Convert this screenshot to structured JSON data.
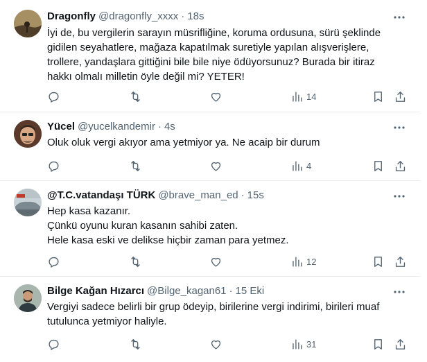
{
  "tweets": [
    {
      "name": "Dragonfly",
      "handle": "@dragonfly_xxxx",
      "separator": "·",
      "time": "18s",
      "lines": [
        "İyi de, bu vergilerin sarayın müsrifliğine, koruma ordusuna, sürü şeklinde",
        "gidilen seyahatlere, mağaza kapatılmak suretiyle yapılan alışverişlere,",
        "trollere, yandaşlara gittiğini bile bile niye ödüyorsunuz? Burada bir itiraz",
        "hakkı olmalı milletin öyle değil mi? YETER!"
      ],
      "views": "14"
    },
    {
      "name": "Yücel",
      "handle": "@yucelkandemir",
      "separator": "·",
      "time": "4s",
      "lines": [
        "Oluk oluk vergi akıyor ama yetmiyor ya. Ne acaip bir durum"
      ],
      "views": "4"
    },
    {
      "name": "@T.C.vatandaşı TÜRK",
      "handle": "@brave_man_ed",
      "separator": "·",
      "time": "15s",
      "lines": [
        "Hep kasa kazanır.",
        "Çünkü oyunu kuran kasanın sahibi zaten.",
        "Hele kasa eski ve delikse hiçbir zaman para yetmez."
      ],
      "views": "12"
    },
    {
      "name": "Bilge Kağan Hızarcı",
      "handle": "@Bilge_kagan61",
      "separator": "·",
      "time": "15 Eki",
      "lines": [
        "Vergiyi sadece belirli bir grup ödeyip, birilerine vergi indirimi, birileri muaf",
        "tutulunca yetmiyor haliyle."
      ],
      "views": "31"
    }
  ],
  "icons": {
    "more": "more-horizontal-icon",
    "reply": "reply-icon",
    "retweet": "retweet-icon",
    "like": "heart-icon",
    "views": "views-bar-chart-icon",
    "bookmark": "bookmark-icon",
    "share": "share-icon"
  },
  "colors": {
    "text": "#0f1419",
    "secondary": "#536471",
    "divider": "#e8ecef",
    "background": "#ffffff"
  }
}
